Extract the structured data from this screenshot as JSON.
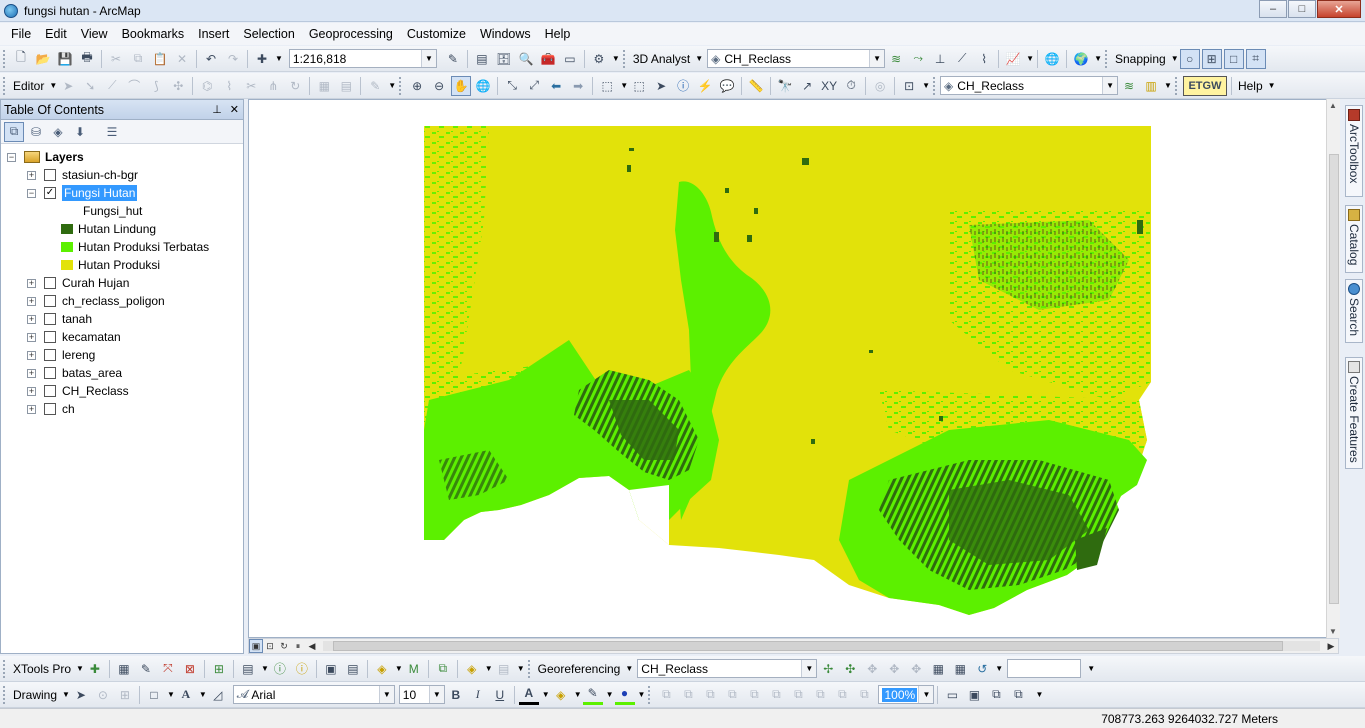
{
  "window": {
    "title": "fungsi hutan - ArcMap",
    "minimize": "–",
    "maximize": "□",
    "close": "✕"
  },
  "menu": [
    "File",
    "Edit",
    "View",
    "Bookmarks",
    "Insert",
    "Selection",
    "Geoprocessing",
    "Customize",
    "Windows",
    "Help"
  ],
  "standard_toolbar": {
    "scale": "1:216,818",
    "analyst_label": "3D Analyst",
    "analyst_layer": "CH_Reclass",
    "snapping_label": "Snapping"
  },
  "editor_toolbar": {
    "editor_label": "Editor",
    "layer": "CH_Reclass",
    "etgw_label": "ETGW",
    "help_label": "Help"
  },
  "toc": {
    "title": "Table Of Contents",
    "pin": "📌",
    "close": "✕",
    "root_label": "Layers",
    "layers": [
      {
        "label": "stasiun-ch-bgr",
        "checked": false,
        "expanded": false
      },
      {
        "label": "Fungsi Hutan",
        "checked": true,
        "expanded": true,
        "selected": true
      },
      {
        "label": "Curah Hujan",
        "checked": false,
        "expanded": false
      },
      {
        "label": "ch_reclass_poligon",
        "checked": false,
        "expanded": false
      },
      {
        "label": "tanah",
        "checked": false,
        "expanded": false
      },
      {
        "label": "kecamatan",
        "checked": false,
        "expanded": false
      },
      {
        "label": "lereng",
        "checked": false,
        "expanded": false
      },
      {
        "label": "batas_area",
        "checked": false,
        "expanded": false
      },
      {
        "label": "CH_Reclass",
        "checked": false,
        "expanded": false
      },
      {
        "label": "ch",
        "checked": false,
        "expanded": false
      }
    ],
    "legend": {
      "field": "Fungsi_hut",
      "classes": [
        {
          "label": "Hutan Lindung",
          "color": "#2f6b0f"
        },
        {
          "label": "Hutan Produksi Terbatas",
          "color": "#5cf000"
        },
        {
          "label": "Hutan Produksi",
          "color": "#e2e20a"
        }
      ]
    }
  },
  "side_tabs": [
    "ArcToolbox",
    "Catalog",
    "Search",
    "Create Features"
  ],
  "xtools_toolbar": {
    "xtools_label": "XTools Pro",
    "georef_label": "Georeferencing",
    "georef_layer": "CH_Reclass"
  },
  "drawing_toolbar": {
    "drawing_label": "Drawing",
    "font": "Arial",
    "font_size": "10",
    "bold": "B",
    "italic": "I",
    "underline": "U",
    "transparency": "100%"
  },
  "status": {
    "coordinates": "708773.263  9264032.727 Meters"
  },
  "colors": {
    "hutan_lindung": "#2f6b0f",
    "hutan_produksi_terbatas": "#5cf000",
    "hutan_produksi": "#e2e20a",
    "selection": "#3399ff"
  }
}
